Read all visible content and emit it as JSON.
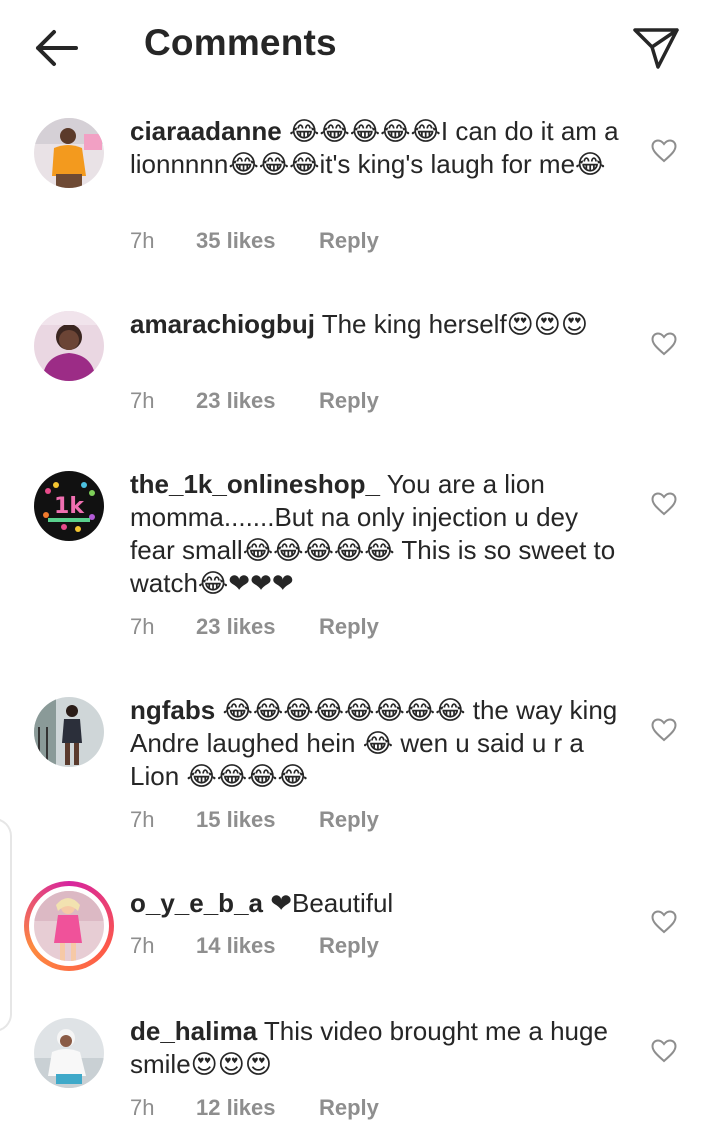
{
  "header": {
    "title": "Comments",
    "back_icon": "arrow-left-icon",
    "share_icon": "paper-plane-icon"
  },
  "colors": {
    "text": "#262626",
    "muted": "#8e8e8e",
    "heart_red": "#e0102b"
  },
  "comments": [
    {
      "username": "ciaraadanne",
      "text": " 😂😂😂😂😂I can do it am a lionnnnn😂😂😂it's king's laugh for me😂",
      "time": "7h",
      "likes": "35 likes",
      "reply": "Reply"
    },
    {
      "username": "amarachiogbuj",
      "text": " The king herself😍😍😍",
      "time": "7h",
      "likes": "23 likes",
      "reply": "Reply"
    },
    {
      "username": "the_1k_onlineshop_",
      "text": " You are a lion momma.......But na only injection u dey fear small😂😂😂😂😂 This is so sweet to watch😂❤❤❤",
      "time": "7h",
      "likes": "23 likes",
      "reply": "Reply"
    },
    {
      "username": "ngfabs",
      "text": " 😂😂😂😂😂😂😂😂 the way king Andre laughed hein 😂 wen u said u r a Lion 😂😂😂😂",
      "time": "7h",
      "likes": "15 likes",
      "reply": "Reply"
    },
    {
      "username": "o_y_e_b_a",
      "text": " ❤Beautiful",
      "time": "7h",
      "likes": "14 likes",
      "reply": "Reply"
    },
    {
      "username": "de_halima",
      "text": " This video brought me a huge smile😍😍😍",
      "time": "7h",
      "likes": "12 likes",
      "reply": "Reply"
    }
  ]
}
